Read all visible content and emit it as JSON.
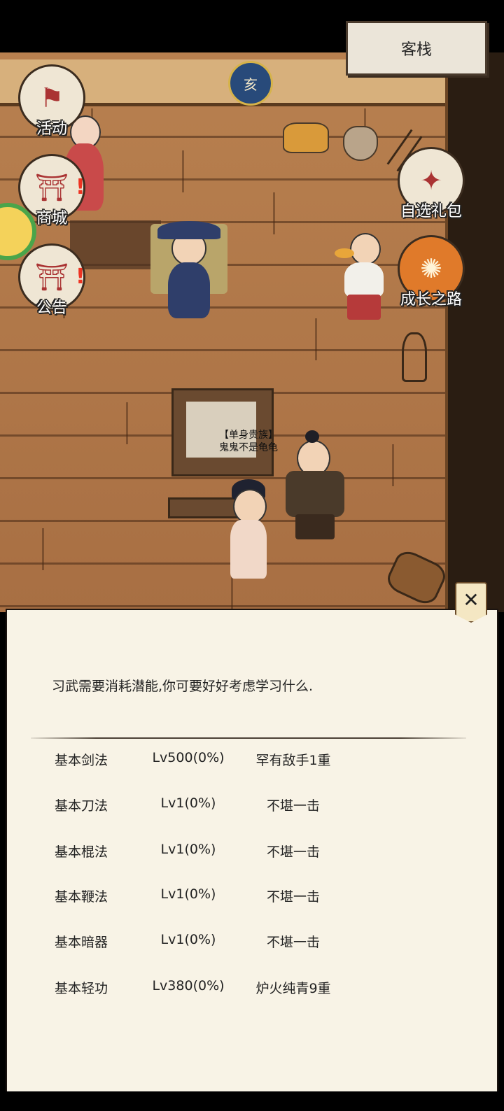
{
  "location": {
    "name": "客栈"
  },
  "time_badge": {
    "glyph": "亥"
  },
  "left_menu": [
    {
      "label": "活动",
      "icon": "flag-icon"
    },
    {
      "label": "商城",
      "icon": "shop-icon"
    },
    {
      "label": "公告",
      "icon": "notice-icon"
    }
  ],
  "right_menu": [
    {
      "label": "自选礼包",
      "icon": "gift-bag-icon"
    },
    {
      "label": "成长之路",
      "icon": "growth-icon"
    }
  ],
  "player": {
    "title": "【单身贵族】",
    "name": "鬼鬼不是龟龟"
  },
  "dialog": {
    "close_symbol": "✕",
    "prompt": "习武需要消耗潜能,你可要好好考虑学习什么.",
    "skills": [
      {
        "name": "基本剑法",
        "level": "Lv500(0%)",
        "rank": "罕有敌手1重"
      },
      {
        "name": "基本刀法",
        "level": "Lv1(0%)",
        "rank": "不堪一击"
      },
      {
        "name": "基本棍法",
        "level": "Lv1(0%)",
        "rank": "不堪一击"
      },
      {
        "name": "基本鞭法",
        "level": "Lv1(0%)",
        "rank": "不堪一击"
      },
      {
        "name": "基本暗器",
        "level": "Lv1(0%)",
        "rank": "不堪一击"
      },
      {
        "name": "基本轻功",
        "level": "Lv380(0%)",
        "rank": "炉火纯青9重"
      }
    ]
  }
}
